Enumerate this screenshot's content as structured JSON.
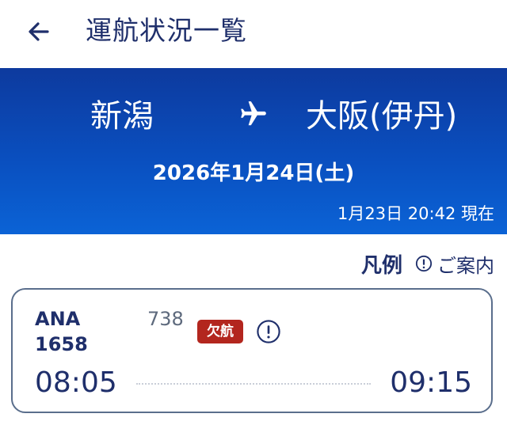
{
  "appbar": {
    "title": "運航状況一覧",
    "back_icon": "arrow-left-icon"
  },
  "route": {
    "from": "新潟",
    "to": "大阪(伊丹)",
    "plane_icon": "airplane-icon",
    "date": "2026年1月24日(土)",
    "updated": "1月23日 20:42 現在"
  },
  "legend": {
    "label": "凡例",
    "guide_label": "ご案内",
    "guide_icon": "info-icon"
  },
  "flights": [
    {
      "airline": "ANA",
      "flight_number": "1658",
      "aircraft": "738",
      "status": "欠航",
      "status_color": "#b3261e",
      "departure": "08:05",
      "arrival": "09:15"
    }
  ],
  "colors": {
    "primary_text": "#1f2f6b",
    "hero_top": "#0d3a9e",
    "hero_bottom": "#0b63d6",
    "card_border": "#5a6e8c"
  }
}
